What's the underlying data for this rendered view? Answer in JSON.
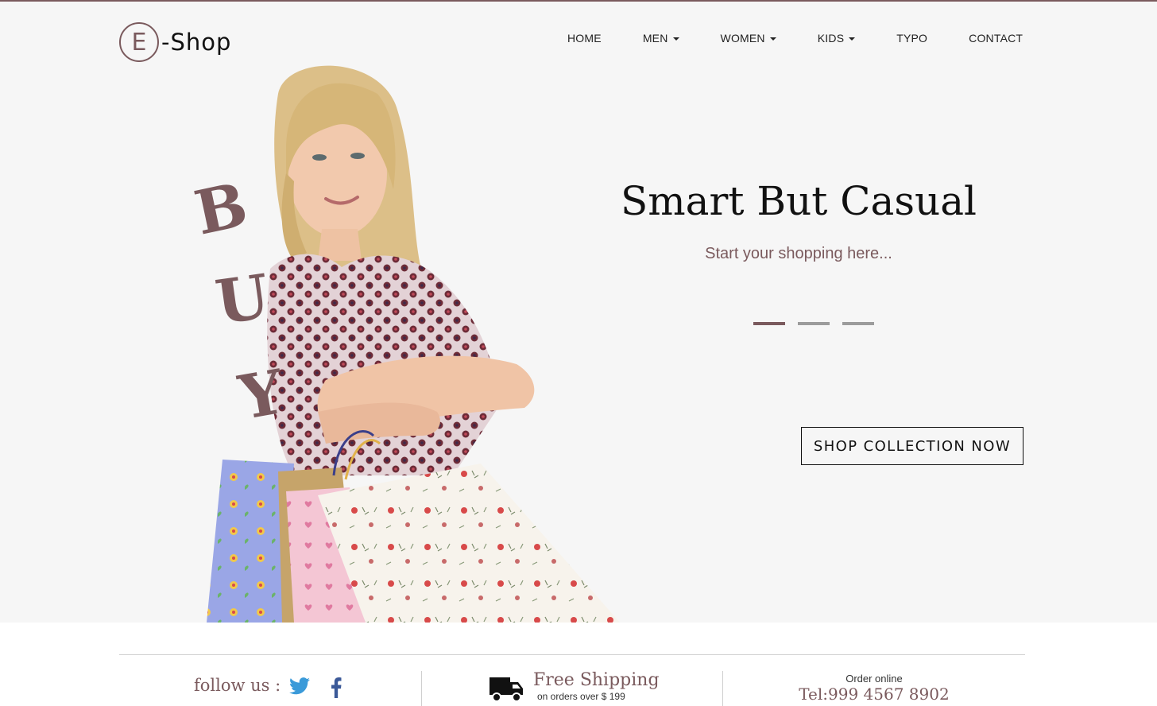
{
  "header": {
    "logo_letter": "E",
    "logo_text": "-Shop",
    "nav": [
      {
        "label": "HOME"
      },
      {
        "label": "MEN"
      },
      {
        "label": "WOMEN"
      },
      {
        "label": "KIDS"
      },
      {
        "label": "TYPO"
      },
      {
        "label": "CONTACT"
      }
    ]
  },
  "hero": {
    "buy_letters": [
      "B",
      "U",
      "Y"
    ],
    "title": "Smart But Casual",
    "subtitle": "Start your shopping here...",
    "slides": {
      "count": 3,
      "active": 1
    },
    "cta_label": "SHOP COLLECTION NOW"
  },
  "footer": {
    "follow_label": "follow us :",
    "social": [
      {
        "icon": "twitter-icon"
      },
      {
        "icon": "facebook-icon"
      }
    ],
    "shipping_title": "Free Shipping",
    "shipping_sub": "on orders over $ 199",
    "order_label": "Order online",
    "order_tel": "Tel:999 4567 8902"
  },
  "colors": {
    "accent": "#7a5a5d",
    "hero_bg": "#f6f6f6",
    "dot_inactive": "#9c9c9c",
    "twitter": "#3a9ad9",
    "facebook": "#3b5998"
  }
}
